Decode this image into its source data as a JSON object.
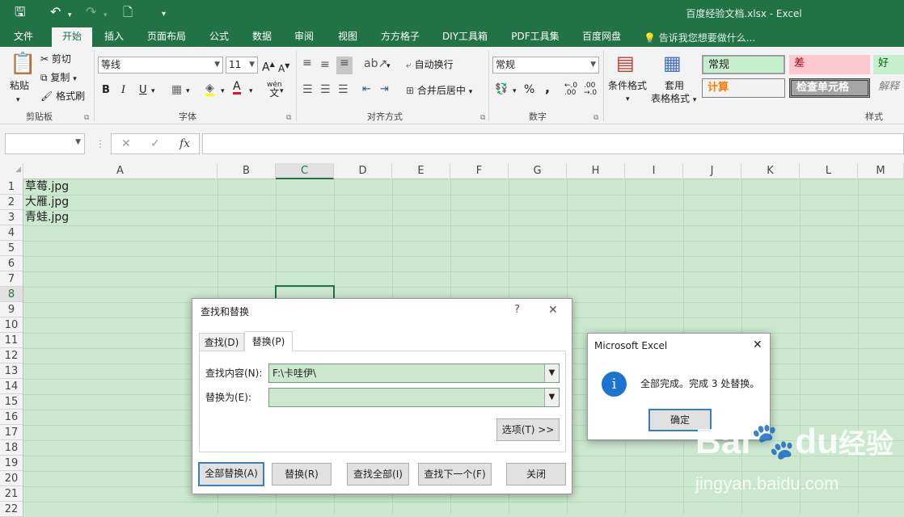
{
  "titlebar": {
    "doc_title": "百度经验文档.xlsx - Excel"
  },
  "tabs": [
    "文件",
    "开始",
    "插入",
    "页面布局",
    "公式",
    "数据",
    "审阅",
    "视图",
    "方方格子",
    "DIY工具箱",
    "PDF工具集",
    "百度网盘"
  ],
  "active_tab": "开始",
  "tell_me": "告诉我您想要做什么...",
  "ribbon": {
    "clipboard": {
      "paste": "粘贴",
      "cut": "剪切",
      "copy": "复制",
      "format_painter": "格式刷",
      "label": "剪贴板"
    },
    "font": {
      "name": "等线",
      "size": "11",
      "grow": "A",
      "shrink": "A",
      "bold": "B",
      "italic": "I",
      "underline": "U",
      "wen": "wén",
      "label": "字体"
    },
    "alignment": {
      "wrap": "自动换行",
      "merge": "合并后居中",
      "label": "对齐方式"
    },
    "number": {
      "format": "常规",
      "percent": "%",
      "comma": ",",
      "label": "数字"
    },
    "styles": {
      "conditional": "条件格式",
      "table_fmt_1": "套用",
      "table_fmt_2": "表格格式",
      "normal": "常规",
      "bad": "差",
      "good": "好",
      "calc": "计算",
      "check": "检查单元格",
      "explain": "解释",
      "label": "样式"
    }
  },
  "formula_bar": {
    "fx": "fx",
    "cancel": "✕",
    "enter": "✓"
  },
  "columns": [
    "A",
    "B",
    "C",
    "D",
    "E",
    "F",
    "G",
    "H",
    "I",
    "J",
    "K",
    "L",
    "M"
  ],
  "rows": [
    "1",
    "2",
    "3",
    "4",
    "5",
    "6",
    "7",
    "8",
    "9",
    "10",
    "11",
    "12",
    "13",
    "14",
    "15",
    "16",
    "17",
    "18",
    "19",
    "20",
    "21",
    "22"
  ],
  "cells": {
    "a1": "草莓.jpg",
    "a2": "大雁.jpg",
    "a3": "青蛙.jpg"
  },
  "find_replace": {
    "title": "查找和替换",
    "help": "?",
    "close_x": "✕",
    "tab_find": "查找(D)",
    "tab_replace": "替换(P)",
    "find_label": "查找内容(N):",
    "find_value": "F:\\卡哇伊\\",
    "replace_label": "替换为(E):",
    "replace_value": "",
    "options": "选项(T) >>",
    "replace_all": "全部替换(A)",
    "replace": "替换(R)",
    "find_all": "查找全部(I)",
    "find_next": "查找下一个(F)",
    "close": "关闭"
  },
  "msgbox": {
    "title": "Microsoft Excel",
    "icon": "i",
    "message": "全部完成。完成 3 处替换。",
    "ok": "确定",
    "close_x": "✕"
  },
  "watermark": {
    "brand_1": "Bai",
    "brand_2": "du",
    "brand_3": "经验",
    "url": "jingyan.baidu.com"
  }
}
